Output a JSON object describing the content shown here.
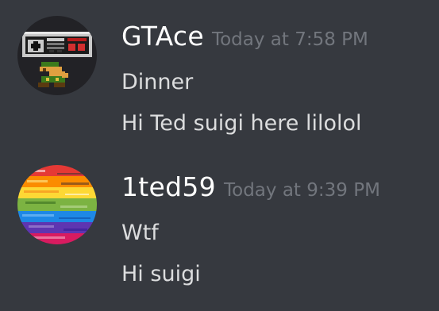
{
  "messages": [
    {
      "author": "GTAce",
      "timestamp": "Today at 7:58 PM",
      "avatar_icon": "nes-controller-mario-icon",
      "lines": [
        "Dinner",
        "Hi Ted suigi here lilolol"
      ]
    },
    {
      "author": "1ted59",
      "timestamp": "Today at 9:39 PM",
      "avatar_icon": "rainbow-glitch-icon",
      "lines": [
        "Wtf",
        "Hi suigi"
      ]
    }
  ],
  "colors": {
    "background": "#36393f",
    "username": "#ffffff",
    "timestamp": "#72767d",
    "message_text": "#dcddde"
  }
}
